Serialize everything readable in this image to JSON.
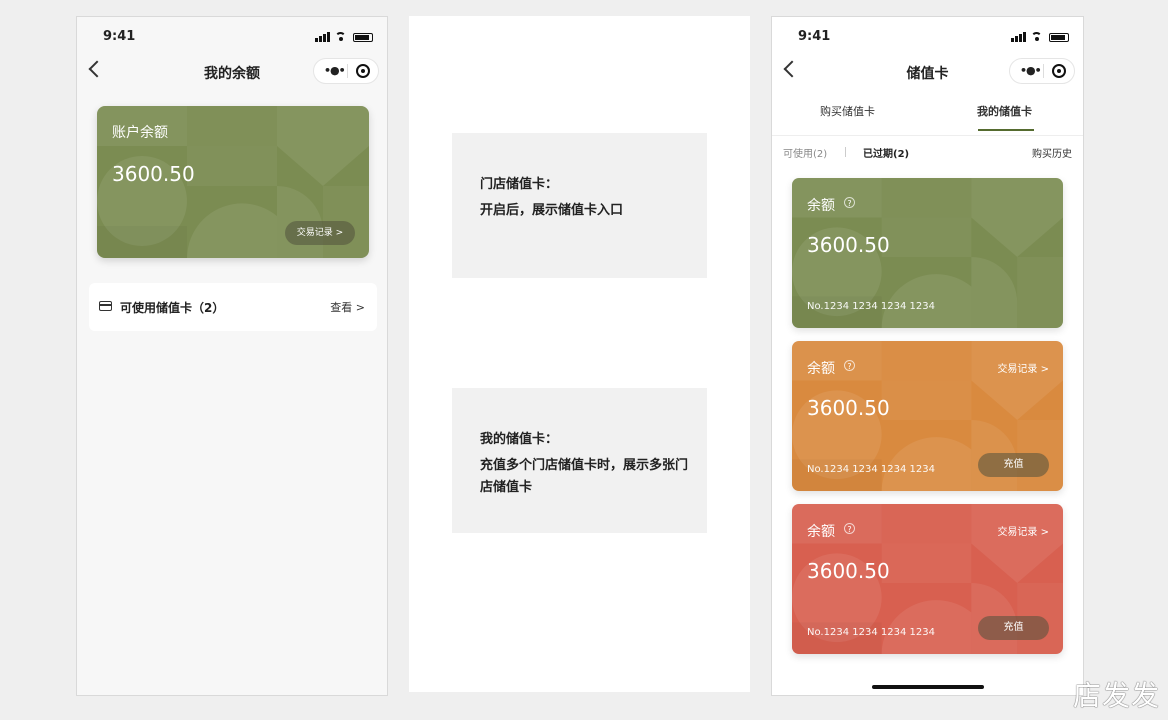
{
  "phone_left": {
    "status_time": "9:41",
    "nav_title": "我的余额",
    "balance_card": {
      "label": "账户余额",
      "amount": "3600.50",
      "transactions": "交易记录 >"
    },
    "available_row": {
      "label": "可使用储值卡（2）",
      "action": "查看 >"
    }
  },
  "notes": [
    {
      "title": "门店储值卡：",
      "desc": "开启后，展示储值卡入口"
    },
    {
      "title": "我的储值卡：",
      "desc": "充值多个门店储值卡时，展示多张门店储值卡"
    }
  ],
  "phone_right": {
    "status_time": "9:41",
    "nav_title": "储值卡",
    "tabs": [
      "购买储值卡",
      "我的储值卡"
    ],
    "filters": {
      "available": "可使用(2)",
      "expired": "已过期(2)",
      "history": "购买历史"
    },
    "cards": [
      {
        "label": "余额",
        "amount": "3600.50",
        "number": "No.1234 1234 1234 1234",
        "color": "#7b8c52",
        "transactions": "",
        "recharge": ""
      },
      {
        "label": "余额",
        "amount": "3600.50",
        "number": "No.1234 1234 1234 1234",
        "color": "#d98a3f",
        "transactions": "交易记录 >",
        "recharge": "充值"
      },
      {
        "label": "余额",
        "amount": "3600.50",
        "number": "No.1234 1234 1234 1234",
        "color": "#d86050",
        "transactions": "交易记录 >",
        "recharge": "充值"
      }
    ]
  },
  "watermark": "店发发",
  "icons": [
    "back-arrow-icon",
    "more-dots-icon",
    "target-icon",
    "card-icon",
    "help-icon",
    "signal-icon",
    "wifi-icon",
    "battery-icon"
  ]
}
